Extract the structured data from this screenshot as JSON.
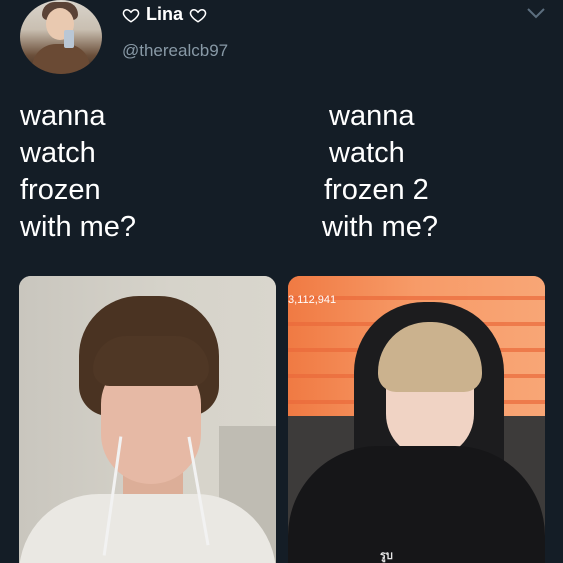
{
  "tweet": {
    "display_name": "Lina",
    "handle": "@therealcb97",
    "heart_icon": "heart-outline-icon",
    "menu_icon": "chevron-down-icon"
  },
  "left_caption": [
    "wanna",
    "watch",
    "frozen",
    "with me?"
  ],
  "right_caption": [
    "wanna",
    "watch",
    "frozen 2",
    "with me?"
  ],
  "images": {
    "right_overlay_count": "3,112,941",
    "right_shirt_text": "รูบ"
  },
  "colors": {
    "background": "#141d26",
    "text": "#ffffff",
    "handle": "#8899a6"
  }
}
